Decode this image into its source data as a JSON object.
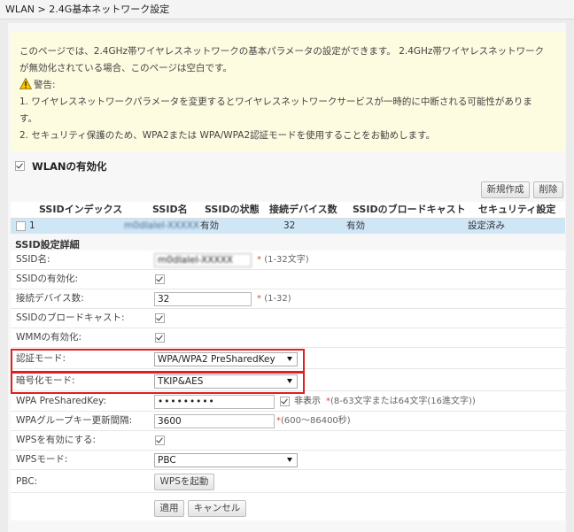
{
  "breadcrumb": "WLAN > 2.4G基本ネットワーク設定",
  "notice": {
    "line1": "このページでは、2.4GHz帯ワイヤレスネットワークの基本パラメータの設定ができます。 2.4GHz帯ワイヤレスネットワーク",
    "line2": "が無効化されている場合、このページは空白です。",
    "warning_title": "警告:",
    "line3": "1. ワイヤレスネットワークパラメータを変更するとワイヤレスネットワークサービスが一時的に中断される可能性がありま",
    "line4": "す。",
    "line5": "2. セキュリティ保護のため、WPA2または WPA/WPA2認証モードを使用することをお勧めします。"
  },
  "wlan_enable_label": "WLANの有効化",
  "buttons": {
    "create": "新規作成",
    "delete": "削除",
    "wps_start": "WPSを起動",
    "apply": "適用",
    "cancel": "キャンセル"
  },
  "ssid_table": {
    "headers": [
      "SSIDインデックス",
      "SSID名",
      "SSIDの状態",
      "接続デバイス数",
      "SSIDのブロードキャスト",
      "セキュリティ設定"
    ],
    "row": {
      "index": "1",
      "name": "m0dIaIeI-XXXXX",
      "status": "有効",
      "devices": "32",
      "broadcast": "有効",
      "security": "設定済み"
    }
  },
  "details_title": "SSID設定詳細",
  "form": {
    "ssid_name": {
      "label": "SSID名:",
      "value": "m0dIaIeI-XXXXX",
      "hint": "(1-32文字)"
    },
    "ssid_enable": {
      "label": "SSIDの有効化:",
      "checked": true
    },
    "devices": {
      "label": "接続デバイス数:",
      "value": "32",
      "hint": "(1-32)"
    },
    "broadcast": {
      "label": "SSIDのブロードキャスト:",
      "checked": true
    },
    "wmm": {
      "label": "WMMの有効化:",
      "checked": true
    },
    "auth_mode": {
      "label": "認証モード:",
      "value": "WPA/WPA2 PreSharedKey"
    },
    "encryption": {
      "label": "暗号化モード:",
      "value": "TKIP&AES"
    },
    "psk": {
      "label": "WPA PreSharedKey:",
      "value": "•••••••••",
      "hide_label": "非表示",
      "hint": "(8-63文字または64文字(16進文字))"
    },
    "group_key": {
      "label": "WPAグループキー更新間隔:",
      "value": "3600",
      "hint": "(600～86400秒)"
    },
    "wps_enable": {
      "label": "WPSを有効にする:",
      "checked": true
    },
    "wps_mode": {
      "label": "WPSモード:",
      "value": "PBC"
    },
    "pbc": {
      "label": "PBC:"
    }
  },
  "colors": {
    "highlight": "#e02020",
    "selected_row": "#cfe6f7",
    "notice_bg": "#fdfbe0"
  }
}
